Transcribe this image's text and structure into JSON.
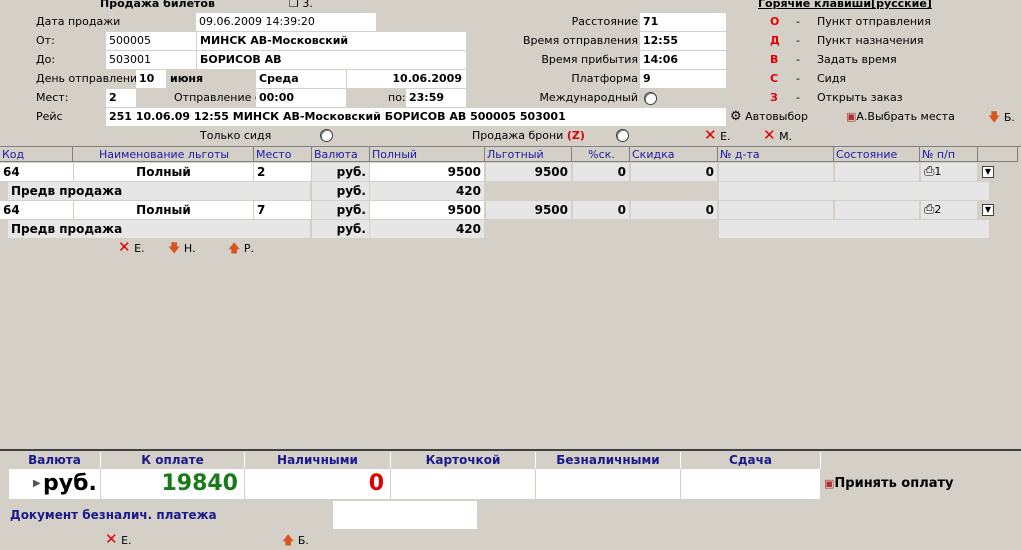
{
  "header": {
    "title": "Продажа билетов",
    "btn3_label": "3.",
    "hotkeys_title": "Горячие клавиши[русские]"
  },
  "form": {
    "sale_date_label": "Дата продажи",
    "sale_date_value": "09.06.2009 14:39:20",
    "from_label": "От:",
    "from_code": "500005",
    "from_name": "МИНСК АВ-Московский",
    "to_label": "До:",
    "to_code": "503001",
    "to_name": "БОРИСОВ АВ",
    "dep_day_label": "День отправления",
    "dep_day": "10",
    "dep_month": "июня",
    "dep_weekday": "Среда",
    "dep_date": "10.06.2009",
    "seats_label": "Мест:",
    "seats_value": "2",
    "dep_from_label": "Отправление с:",
    "dep_from_value": "00:00",
    "to_time_label": "по:",
    "to_time_value": "23:59",
    "route_label": "Рейс",
    "route_value": "251 10.06.09 12:55 МИНСК АВ-Московский БОРИСОВ АВ 500005 503001",
    "distance_label": "Расстояние",
    "distance_value": "71",
    "dep_time_label": "Время отправления",
    "dep_time_value": "12:55",
    "arr_time_label": "Время прибытия",
    "arr_time_value": "14:06",
    "platform_label": "Платформа",
    "platform_value": "9",
    "intl_label": "Международный",
    "only_sitting_label": "Только сидя",
    "reserve_sale_label": "Продажа брони",
    "reserve_sale_key": "(Z)",
    "autoselect_label": "Автовыбор",
    "choose_seats_label": "А.Выбрать места",
    "btn_b_label": "Б.",
    "btn_e_label": "Е.",
    "btn_m_label": "М."
  },
  "hotkeys": [
    {
      "key": "О",
      "dash": "-",
      "desc": "Пункт отправления"
    },
    {
      "key": "Д",
      "dash": "-",
      "desc": "Пункт назначения"
    },
    {
      "key": "В",
      "dash": "-",
      "desc": "Задать время"
    },
    {
      "key": "С",
      "dash": "-",
      "desc": "Сидя"
    },
    {
      "key": "З",
      "dash": "-",
      "desc": "Открыть заказ"
    }
  ],
  "table": {
    "columns": [
      "Код",
      "Наименование льготы",
      "Место",
      "Валюта",
      "Полный",
      "Льготный",
      "%ск.",
      "Скидка",
      "№ д-та",
      "Состояние",
      "№ п/п"
    ],
    "rows": [
      {
        "code": "64",
        "benefit": "Полный",
        "seat": "2",
        "currency": "руб.",
        "full": "9500",
        "discounted": "9500",
        "pct": "0",
        "discount": "0",
        "doc": "",
        "state": "",
        "num": "1",
        "sub_label": "Предв продажа",
        "sub_currency": "руб.",
        "sub_amount": "420"
      },
      {
        "code": "64",
        "benefit": "Полный",
        "seat": "7",
        "currency": "руб.",
        "full": "9500",
        "discounted": "9500",
        "pct": "0",
        "discount": "0",
        "doc": "",
        "state": "",
        "num": "2",
        "sub_label": "Предв продажа",
        "sub_currency": "руб.",
        "sub_amount": "420"
      }
    ],
    "actions": {
      "e": "Е.",
      "n": "Н.",
      "r": "Р."
    }
  },
  "payment": {
    "headers": [
      "Валюта",
      "К оплате",
      "Наличными",
      "Карточкой",
      "Безналичными",
      "Сдача"
    ],
    "currency": "руб.",
    "to_pay": "19840",
    "cash": "0",
    "card": "",
    "noncash": "",
    "change": "",
    "accept_label": "Принять оплату",
    "doc_label": "Документ безналич. платежа",
    "doc_value": "",
    "btn_e": "Е.",
    "btn_b": "Б.",
    "colors": {
      "to_pay": "#1a7a1a",
      "cash": "#e00000"
    }
  }
}
